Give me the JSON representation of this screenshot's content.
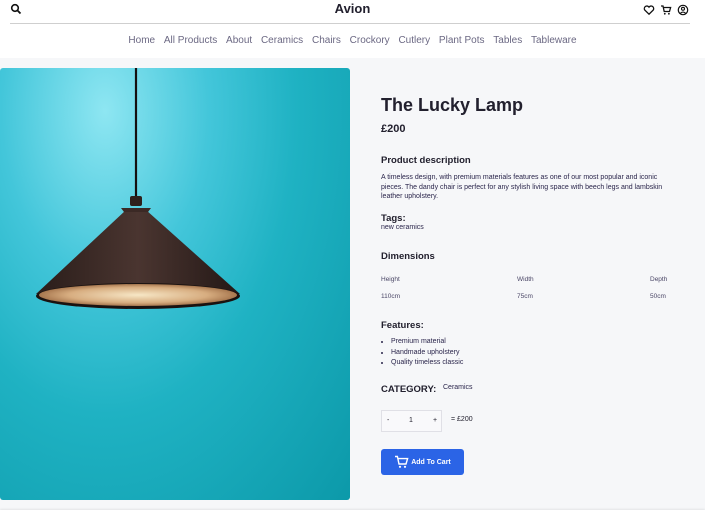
{
  "brand": "Avion",
  "nav": [
    "Home",
    "All Products",
    "About",
    "Ceramics",
    "Chairs",
    "Crockory",
    "Cutlery",
    "Plant Pots",
    "Tables",
    "Tableware"
  ],
  "product": {
    "title": "The Lucky Lamp",
    "price": "£200",
    "description_heading": "Product description",
    "description": "A timeless design, with premium materials features as one of our most popular and iconic pieces. The dandy chair is perfect for any stylish living space with beech legs and lambskin leather upholstery.",
    "tags_heading": "Tags:",
    "tags": "new ceramics",
    "dimensions_heading": "Dimensions",
    "dimensions": [
      {
        "label": "Height",
        "value": "110cm"
      },
      {
        "label": "Width",
        "value": "75cm"
      },
      {
        "label": "Depth",
        "value": "50cm"
      }
    ],
    "features_heading": "Features:",
    "features": [
      "Premium material",
      "Handmade upholstery",
      "Quality timeless classic"
    ],
    "category_heading": "CATEGORY:",
    "category": "Ceramics",
    "quantity": {
      "minus": "-",
      "value": "1",
      "plus": "+"
    },
    "total": "= £200",
    "add_to_cart": "Add To Cart"
  },
  "colors": {
    "accent": "#2b64e6",
    "text": "#22202e",
    "image_bg": "#1fb2c3"
  },
  "icons": [
    "search-icon",
    "heart-icon",
    "cart-icon",
    "user-icon",
    "cart-button-icon"
  ]
}
